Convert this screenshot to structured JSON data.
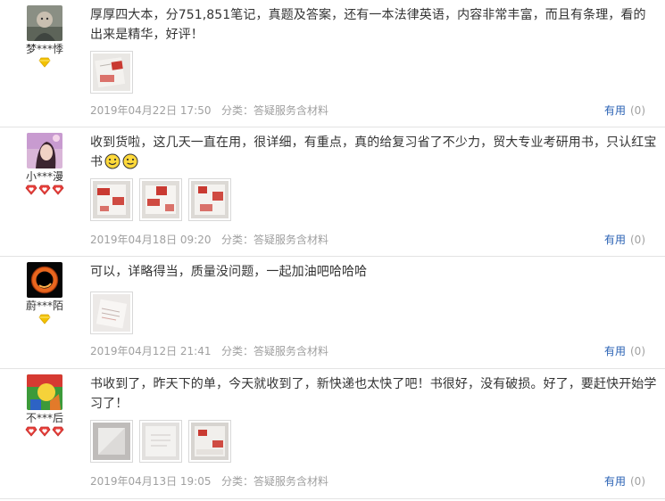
{
  "reviews": [
    {
      "username": "梦***悸",
      "text": "厚厚四大本，分751,851笔记，真题及答案，还有一本法律英语，内容非常丰富，而且有条理，看的出来是精华，好评！",
      "emojis": [],
      "rank_icon": "gold-diamond-icon",
      "rank_count": 1,
      "date": "2019年04月22日 17:50",
      "category_label": "分类：",
      "category": "答疑服务含材料",
      "useful_label": "有用",
      "useful_count": "(0)",
      "photo_count": 1
    },
    {
      "username": "小***漫",
      "text": "收到货啦，这几天一直在用，很详细，有重点，真的给复习省了不少力，贸大专业考研用书，只认红宝书",
      "emojis": [
        "grin-emoji-icon",
        "smile-emoji-icon"
      ],
      "rank_icon": "red-heart-diamond-icon",
      "rank_count": 3,
      "date": "2019年04月18日 09:20",
      "category_label": "分类：",
      "category": "答疑服务含材料",
      "useful_label": "有用",
      "useful_count": "(0)",
      "photo_count": 3
    },
    {
      "username": "蔚***陌",
      "text": "可以，详略得当，质量没问题，一起加油吧哈哈哈",
      "emojis": [],
      "rank_icon": "gold-diamond-icon",
      "rank_count": 1,
      "date": "2019年04月12日 21:41",
      "category_label": "分类：",
      "category": "答疑服务含材料",
      "useful_label": "有用",
      "useful_count": "(0)",
      "photo_count": 1
    },
    {
      "username": "不***后",
      "text": "书收到了，昨天下的单，今天就收到了，新快递也太快了吧！书很好，没有破损。好了，要赶快开始学习了！",
      "emojis": [],
      "rank_icon": "red-heart-diamond-icon",
      "rank_count": 3,
      "date": "2019年04月13日 19:05",
      "category_label": "分类：",
      "category": "答疑服务含材料",
      "useful_label": "有用",
      "useful_count": "(0)",
      "photo_count": 3
    }
  ],
  "colors": {
    "link": "#2a62b4",
    "meta": "#a0a0a0",
    "divider": "#e3e3e3",
    "gold": "#f2c200",
    "red": "#e8403c"
  }
}
